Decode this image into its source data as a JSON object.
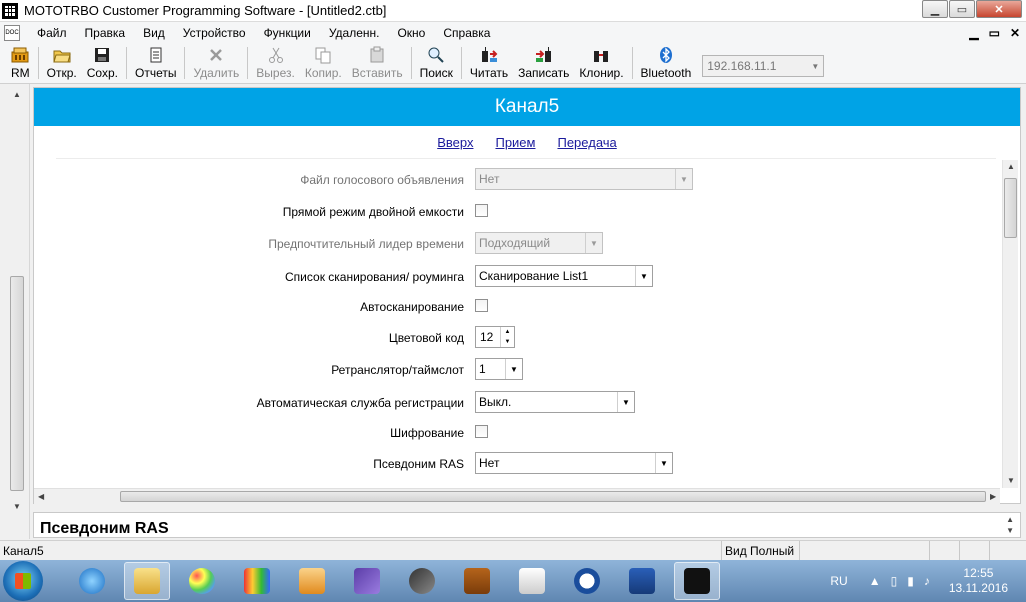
{
  "window": {
    "title": "MOTOTRBO Customer Programming Software - [Untitled2.ctb]",
    "minimize_glyph": "▁",
    "maximize_glyph": "▭",
    "close_glyph": "✕"
  },
  "menubar": {
    "items": [
      "Файл",
      "Правка",
      "Вид",
      "Устройство",
      "Функции",
      "Удаленн.",
      "Окно",
      "Справка"
    ],
    "mdi_minimize": "▁",
    "mdi_restore": "▭",
    "mdi_close": "✕"
  },
  "toolbar": {
    "rm": "RM",
    "open": "Откр.",
    "save": "Сохр.",
    "reports": "Отчеты",
    "delete": "Удалить",
    "cut": "Вырез.",
    "copy": "Копир.",
    "paste": "Вставить",
    "search": "Поиск",
    "read": "Читать",
    "write": "Записать",
    "clone": "Клонир.",
    "bluetooth": "Bluetooth",
    "ip_address": "192.168.11.1"
  },
  "channel": {
    "title": "Канал5",
    "links": {
      "up": "Вверх",
      "receive": "Прием",
      "transmit": "Передача"
    },
    "fields": {
      "voice_announcement": {
        "label": "Файл голосового объявления",
        "value": "Нет"
      },
      "dual_capacity_direct": {
        "label": "Прямой режим двойной емкости"
      },
      "timing_leader": {
        "label": "Предпочтительный лидер времени",
        "value": "Подходящий"
      },
      "scan_list": {
        "label": "Список сканирования/ роуминга",
        "value": "Сканирование List1"
      },
      "auto_scan": {
        "label": "Автосканирование"
      },
      "color_code": {
        "label": "Цветовой код",
        "value": "12"
      },
      "repeater_slot": {
        "label": "Ретранслятор/таймслот",
        "value": "1"
      },
      "auto_registration": {
        "label": "Автоматическая служба регистрации",
        "value": "Выкл."
      },
      "encryption": {
        "label": "Шифрование"
      },
      "ras_alias": {
        "label": "Псевдоним RAS",
        "value": "Нет"
      }
    }
  },
  "help_pane": {
    "title": "Псевдоним RAS"
  },
  "statusbar": {
    "left": "Канал5",
    "view": "Вид Полный"
  },
  "taskbar": {
    "language": "RU",
    "time": "12:55",
    "date": "13.11.2016"
  },
  "colors": {
    "header_band": "#00a3e6",
    "link": "#1a1a9c"
  }
}
